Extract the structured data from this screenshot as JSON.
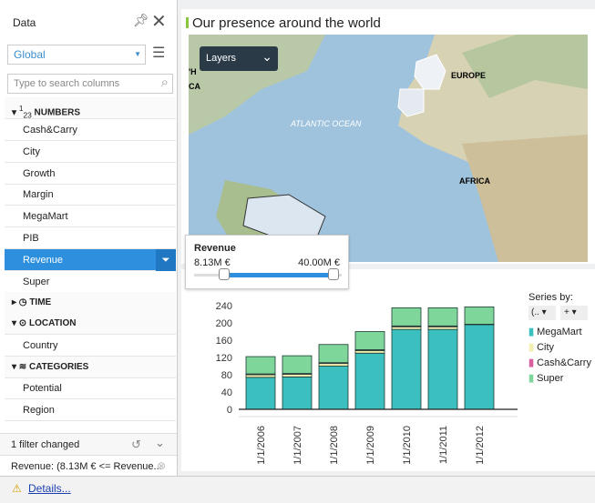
{
  "sidebar": {
    "title": "Data",
    "dataset": "Global",
    "search_placeholder": "Type to search columns",
    "sections": {
      "numbers": "NUMBERS",
      "time": "TIME",
      "location": "LOCATION",
      "categories": "CATEGORIES"
    },
    "numbers": [
      "Cash&Carry",
      "City",
      "Growth",
      "Margin",
      "MegaMart",
      "PIB",
      "Revenue",
      "Super"
    ],
    "location": [
      "Country"
    ],
    "categories": [
      "Potential",
      "Region"
    ],
    "selected": "Revenue",
    "filter_status": "1 filter changed",
    "filter_desc": "Revenue: (8.13M € <= Revenue..."
  },
  "map": {
    "title": "Our presence around the world",
    "layers_label": "Layers",
    "labels": {
      "europe": "EUROPE",
      "africa": "AFRICA",
      "ocean": "ATLANTIC OCEAN",
      "na1": "'H",
      "na2": "CA"
    }
  },
  "popup": {
    "title": "Revenue",
    "min": "8.13M €",
    "max": "40.00M €",
    "range_low_fraction": 0.0,
    "range_high_fraction": 1.0
  },
  "legend": {
    "title": "Series by:",
    "dropdown1": "(..",
    "dropdown2": "+"
  },
  "details_link": "Details...",
  "colors": {
    "accent": "#2d8fde",
    "title_bar": "#8cc63f"
  },
  "chart_data": {
    "type": "bar",
    "stacked": true,
    "categories": [
      "1/1/2006",
      "1/1/2007",
      "1/1/2008",
      "1/1/2009",
      "1/1/2010",
      "1/1/2011",
      "1/1/2012"
    ],
    "ylim": [
      0,
      260
    ],
    "yticks": [
      0,
      40,
      80,
      120,
      160,
      200,
      240
    ],
    "series": [
      {
        "name": "MegaMart",
        "color": "#3cbfbf",
        "values": [
          74,
          75,
          100,
          130,
          185,
          185,
          196
        ]
      },
      {
        "name": "City",
        "color": "#f3f0b0",
        "values": [
          6,
          6,
          6,
          6,
          6,
          6,
          0
        ]
      },
      {
        "name": "Cash&Carry",
        "color": "#d9609e",
        "values": [
          2,
          2,
          2,
          2,
          2,
          2,
          1
        ]
      },
      {
        "name": "Super",
        "color": "#7fd69a",
        "values": [
          40,
          41,
          42,
          42,
          42,
          42,
          40
        ]
      }
    ]
  }
}
